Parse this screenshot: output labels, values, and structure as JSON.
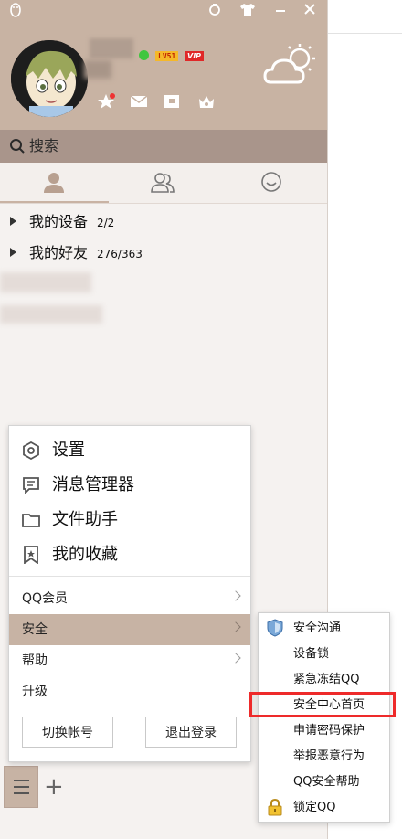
{
  "window": {
    "titlebar_icons": [
      "penguin-icon",
      "skin-icon",
      "shirt-icon",
      "minimize-icon",
      "close-icon"
    ]
  },
  "profile": {
    "level_badge": "LV51",
    "vip_badge": "VIP",
    "status_color": "#3fc63f",
    "toolbar_icons": [
      "qzone-star-icon",
      "mail-icon",
      "wallet-icon",
      "crown-icon"
    ]
  },
  "search": {
    "placeholder": "搜索"
  },
  "tabs": [
    {
      "name": "contacts",
      "icon": "person-icon",
      "active": true
    },
    {
      "name": "groups",
      "icon": "group-icon",
      "active": false
    },
    {
      "name": "conversations",
      "icon": "chat-bubble-icon",
      "active": false
    }
  ],
  "contacts": {
    "groups": [
      {
        "name": "我的设备",
        "count": "2/2"
      },
      {
        "name": "我的好友",
        "count": "276/363"
      }
    ]
  },
  "main_menu": {
    "items": [
      {
        "label": "设置",
        "icon": "settings-icon"
      },
      {
        "label": "消息管理器",
        "icon": "message-manager-icon"
      },
      {
        "label": "文件助手",
        "icon": "folder-icon"
      },
      {
        "label": "我的收藏",
        "icon": "bookmark-icon"
      }
    ],
    "sub_items": [
      {
        "label": "QQ会员",
        "has_submenu": true
      },
      {
        "label": "安全",
        "has_submenu": true,
        "active": true
      },
      {
        "label": "帮助",
        "has_submenu": true
      },
      {
        "label": "升级",
        "has_submenu": false
      }
    ],
    "switch_account": "切换帐号",
    "logout": "退出登录"
  },
  "security_submenu": {
    "items": [
      {
        "label": "安全沟通",
        "icon": "shield-icon"
      },
      {
        "label": "设备锁",
        "icon": ""
      },
      {
        "label": "紧急冻结QQ",
        "icon": ""
      },
      {
        "label": "安全中心首页",
        "icon": "",
        "highlighted": true
      },
      {
        "label": "申请密码保护",
        "icon": ""
      },
      {
        "label": "举报恶意行为",
        "icon": ""
      },
      {
        "label": "QQ安全帮助",
        "icon": ""
      },
      {
        "label": "锁定QQ",
        "icon": "lock-icon"
      }
    ],
    "highlight_color": "#ee2a2a"
  },
  "colors": {
    "header": "#c8b3a3",
    "search_bar": "#a9958b",
    "menu_active": "#c7b3a4"
  }
}
